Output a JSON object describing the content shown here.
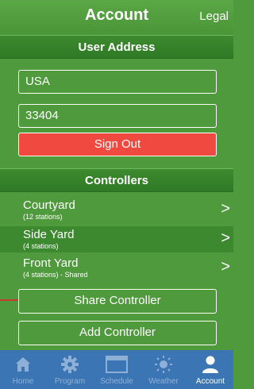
{
  "header": {
    "title": "Account",
    "legal_label": "Legal"
  },
  "user_address": {
    "section_title": "User Address",
    "country_value": "USA",
    "zip_value": "33404",
    "sign_out_label": "Sign Out"
  },
  "controllers": {
    "section_title": "Controllers",
    "items": [
      {
        "name": "Courtyard",
        "detail": "(12 stations)"
      },
      {
        "name": "Side Yard",
        "detail": "(4 stations)"
      },
      {
        "name": "Front Yard",
        "detail": "(4 stations) - Shared"
      }
    ],
    "share_label": "Share Controller",
    "add_label": "Add Controller"
  },
  "tabs": [
    {
      "label": "Home",
      "icon": "home-icon"
    },
    {
      "label": "Program",
      "icon": "gear-icon"
    },
    {
      "label": "Schedule",
      "icon": "schedule-icon"
    },
    {
      "label": "Weather",
      "icon": "sun-icon"
    },
    {
      "label": "Account",
      "icon": "person-icon",
      "active": true
    }
  ],
  "colors": {
    "background": "#4f9a3c",
    "sign_out": "#f04a40",
    "tab_bar": "#3c75b3",
    "pointer_line": "#c83a2f"
  }
}
